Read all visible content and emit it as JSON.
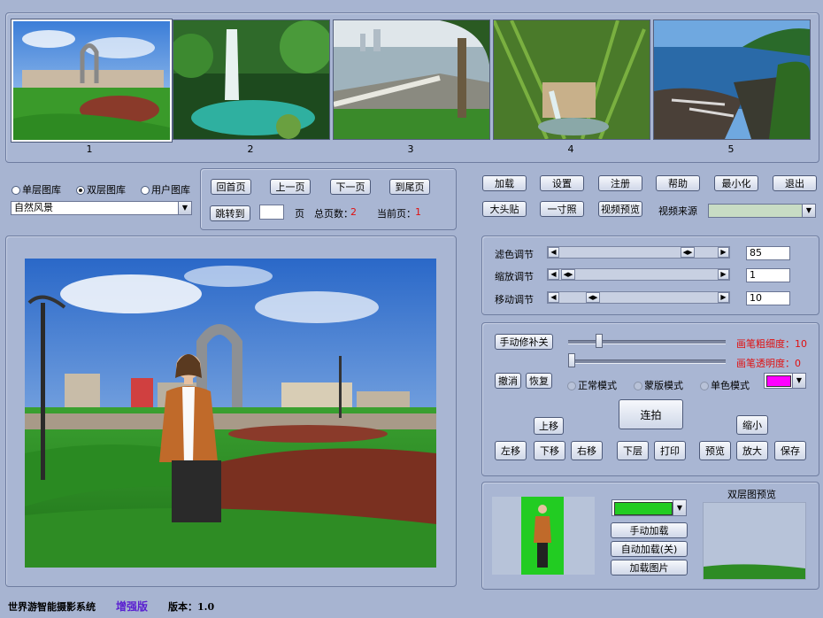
{
  "gallery": {
    "thumbnails": [
      {
        "num": "1"
      },
      {
        "num": "2"
      },
      {
        "num": "3"
      },
      {
        "num": "4"
      },
      {
        "num": "5"
      }
    ]
  },
  "library": {
    "radio_single": "单层图库",
    "radio_double": "双层图库",
    "radio_user": "用户图库",
    "category": "自然风景"
  },
  "paging": {
    "first": "回首页",
    "prev": "上一页",
    "next": "下一页",
    "last": "到尾页",
    "jump": "跳转到",
    "page_unit": "页",
    "total_label": "总页数：",
    "total_value": "2",
    "current_label": "当前页：",
    "current_value": "1"
  },
  "toolbar": {
    "load": "加载",
    "settings": "设置",
    "register": "注册",
    "help": "帮助",
    "minimize": "最小化",
    "exit": "退出",
    "big_head": "大头贴",
    "one_inch": "一寸照",
    "video_preview": "视频预览",
    "video_source_label": "视频来源"
  },
  "adjust": {
    "filter_label": "滤色调节",
    "filter_value": "85",
    "zoom_label": "缩放调节",
    "zoom_value": "1",
    "move_label": "移动调节",
    "move_value": "10"
  },
  "edit": {
    "manual_fix": "手动修补关",
    "brush_size_label": "画笔粗细度：",
    "brush_size_value": "10",
    "brush_opacity_label": "画笔透明度：",
    "brush_opacity_value": "0",
    "undo": "撤消",
    "restore": "恢复",
    "mode_normal": "正常模式",
    "mode_mask": "蒙版模式",
    "mode_mono": "单色模式",
    "mono_color": "#ff00ff",
    "move_up": "上移",
    "move_left": "左移",
    "move_down": "下移",
    "move_right": "右移",
    "burst": "连拍",
    "shrink": "缩小",
    "lower_layer": "下层",
    "print": "打印",
    "preview": "预览",
    "enlarge": "放大",
    "save": "保存"
  },
  "layers": {
    "bg_color": "#22cc22",
    "manual_load": "手动加载",
    "auto_load": "自动加载(关)",
    "load_image": "加载图片",
    "double_preview_label": "双层图预览"
  },
  "status": {
    "app_name": "世界游智能摄影系统",
    "edition": "增强版",
    "version_label": "版本：",
    "version_value": "1.0"
  }
}
